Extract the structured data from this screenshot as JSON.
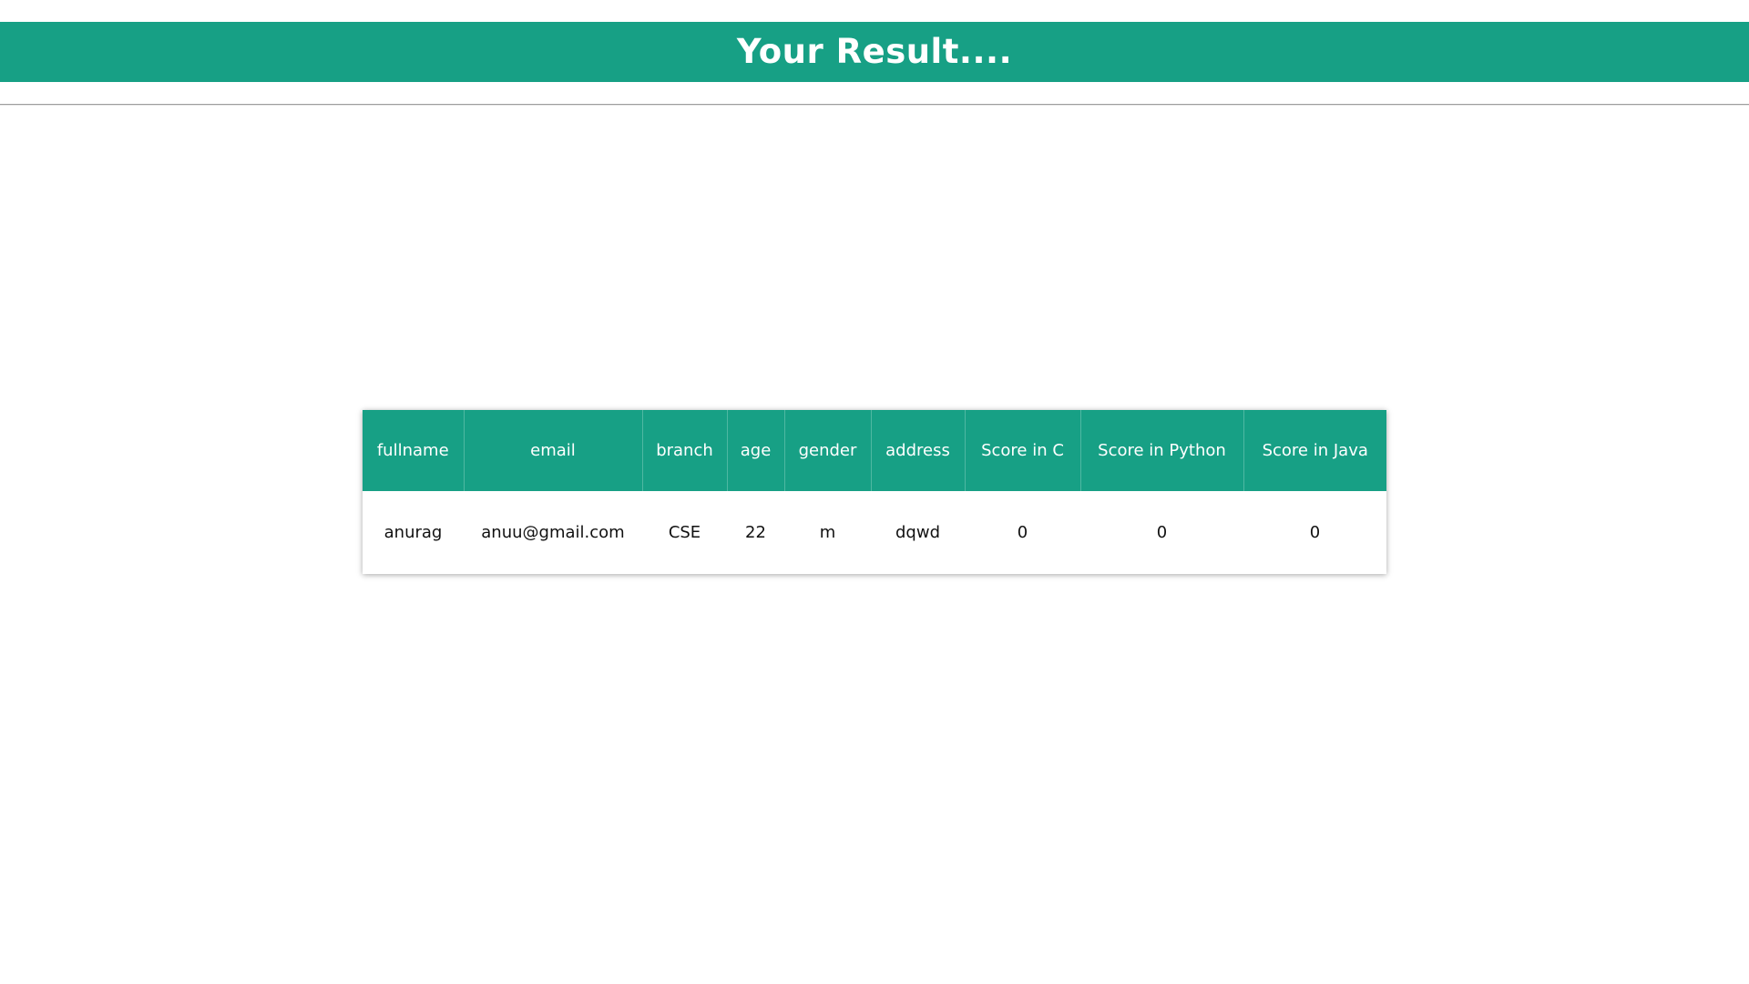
{
  "header": {
    "title": "Your Result...."
  },
  "table": {
    "columns": [
      "fullname",
      "email",
      "branch",
      "age",
      "gender",
      "address",
      "Score in C",
      "Score in Python",
      "Score in Java"
    ],
    "rows": [
      [
        "anurag",
        "anuu@gmail.com",
        "CSE",
        "22",
        "m",
        "dqwd",
        "0",
        "0",
        "0"
      ]
    ]
  },
  "colors": {
    "accent": "#17a085",
    "background": "#ffffff",
    "text": "#111111"
  }
}
